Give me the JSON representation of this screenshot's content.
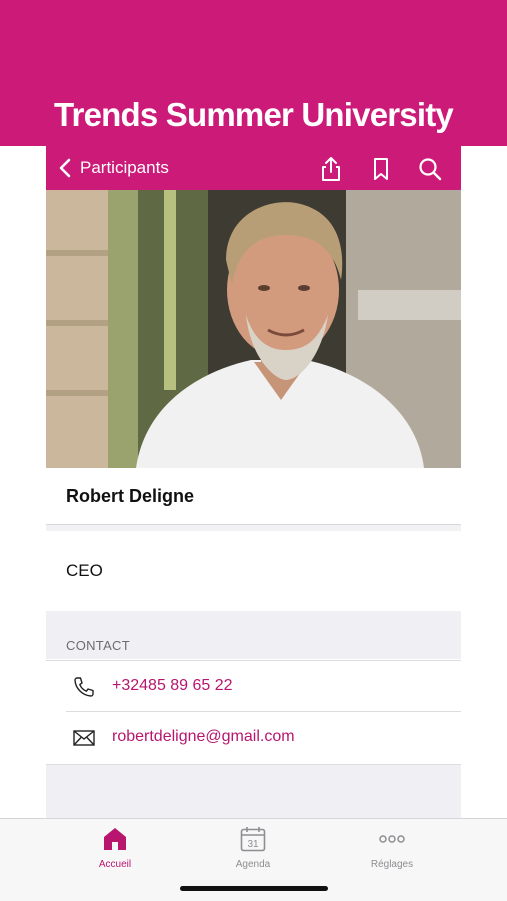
{
  "banner": {
    "title": "Trends Summer University"
  },
  "navbar": {
    "back_label": "Participants"
  },
  "profile": {
    "name": "Robert Deligne",
    "role": "CEO",
    "section_label": "CONTACT",
    "phone": "+32485 89 65 22",
    "email": "robertdeligne@gmail.com"
  },
  "tabs": [
    {
      "label": "Accueil",
      "icon": "home-icon",
      "active": true
    },
    {
      "label": "Agenda",
      "icon": "calendar-icon",
      "active": false,
      "badge": "31"
    },
    {
      "label": "Réglages",
      "icon": "more-icon",
      "active": false
    }
  ],
  "colors": {
    "accent": "#cc1a79",
    "link": "#b8166e",
    "inactive": "#8e8e93"
  }
}
